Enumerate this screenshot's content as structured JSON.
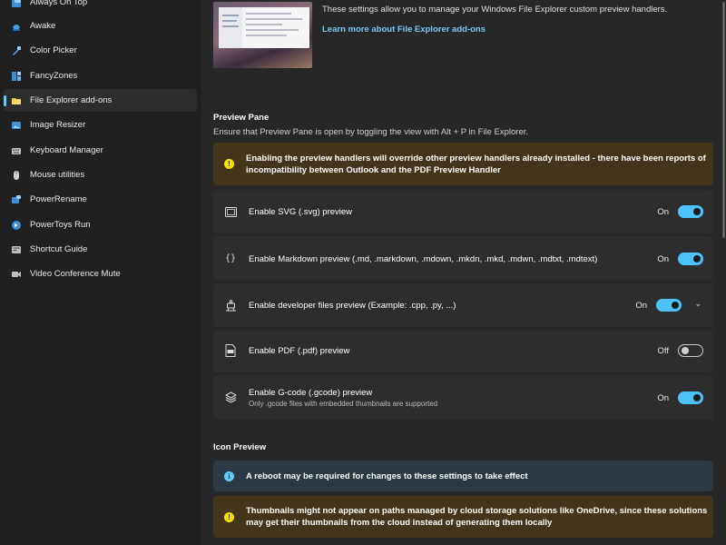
{
  "sidebar": {
    "items": [
      {
        "label": "Always On Top",
        "icon": "always-on-top-icon",
        "selected": false
      },
      {
        "label": "Awake",
        "icon": "awake-icon",
        "selected": false
      },
      {
        "label": "Color Picker",
        "icon": "color-picker-icon",
        "selected": false
      },
      {
        "label": "FancyZones",
        "icon": "fancyzones-icon",
        "selected": false
      },
      {
        "label": "File Explorer add-ons",
        "icon": "folder-icon",
        "selected": true
      },
      {
        "label": "Image Resizer",
        "icon": "image-resizer-icon",
        "selected": false
      },
      {
        "label": "Keyboard Manager",
        "icon": "keyboard-icon",
        "selected": false
      },
      {
        "label": "Mouse utilities",
        "icon": "mouse-icon",
        "selected": false
      },
      {
        "label": "PowerRename",
        "icon": "power-rename-icon",
        "selected": false
      },
      {
        "label": "PowerToys Run",
        "icon": "powertoys-run-icon",
        "selected": false
      },
      {
        "label": "Shortcut Guide",
        "icon": "shortcut-guide-icon",
        "selected": false
      },
      {
        "label": "Video Conference Mute",
        "icon": "video-conference-icon",
        "selected": false
      }
    ]
  },
  "header": {
    "description": "These settings allow you to manage your Windows File Explorer custom preview handlers.",
    "link": "Learn more about File Explorer add-ons"
  },
  "preview_pane": {
    "title": "Preview Pane",
    "subtitle": "Ensure that Preview Pane is open by toggling the view with Alt + P in File Explorer.",
    "warning": "Enabling the preview handlers will override other preview handlers already installed - there have been reports of incompatibility between Outlook and the PDF Preview Handler",
    "items": [
      {
        "label": "Enable SVG (.svg) preview",
        "state": "On",
        "on": true,
        "icon": "image-frame-icon"
      },
      {
        "label": "Enable Markdown preview  (.md, .markdown, .mdown, .mkdn, .mkd, .mdwn, .mdtxt, .mdtext)",
        "state": "On",
        "on": true,
        "icon": "braces-icon"
      },
      {
        "label": "Enable developer files preview (Example: .cpp, .py, ...)",
        "state": "On",
        "on": true,
        "icon": "developer-icon",
        "expandable": true
      },
      {
        "label": "Enable PDF (.pdf) preview",
        "state": "Off",
        "on": false,
        "icon": "pdf-icon"
      },
      {
        "label": "Enable G-code (.gcode) preview",
        "sublabel": "Only .gcode files with embedded thumbnails are supported",
        "state": "On",
        "on": true,
        "icon": "layers-icon"
      }
    ]
  },
  "icon_preview": {
    "title": "Icon Preview",
    "info": "A reboot may be required for changes to these settings to take effect",
    "warning": "Thumbnails might not appear on paths managed by cloud storage solutions like OneDrive, since these solutions may get their thumbnails from the cloud instead of generating them locally"
  },
  "colors": {
    "accent": "#4cc2ff",
    "warning_bg": "#433519",
    "info_bg": "#2a3943",
    "card_bg": "#2d2d2d"
  }
}
